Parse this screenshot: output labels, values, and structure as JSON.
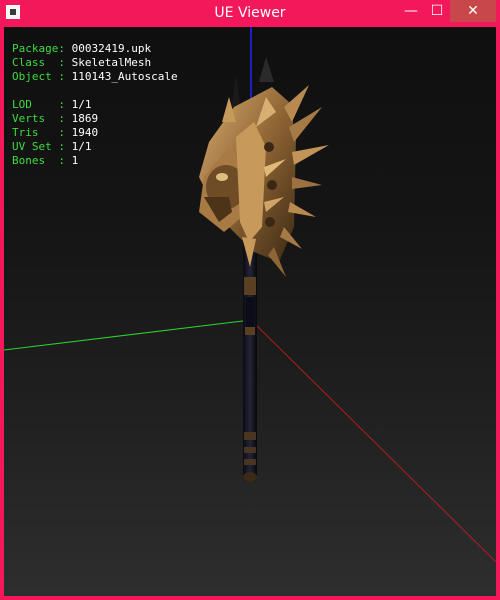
{
  "window": {
    "title": "UE Viewer",
    "minimize_glyph": "—",
    "maximize_glyph": "☐",
    "close_glyph": "✕"
  },
  "info": {
    "package_label": "Package:",
    "package_value": "00032419.upk",
    "class_label": "Class  :",
    "class_value": "SkeletalMesh",
    "object_label": "Object :",
    "object_value": "110143_Autoscale",
    "lod_label": "LOD    :",
    "lod_value": "1/1",
    "verts_label": "Verts  :",
    "verts_value": "1869",
    "tris_label": "Tris   :",
    "tris_value": "1940",
    "uvset_label": "UV Set :",
    "uvset_value": "1/1",
    "bones_label": "Bones  :",
    "bones_value": "1"
  },
  "colors": {
    "frame": "#f2185a",
    "label_green": "#3edc3e",
    "axis_x": "#b01e1e",
    "axis_y": "#2fcf2f",
    "axis_z": "#2222ff"
  }
}
